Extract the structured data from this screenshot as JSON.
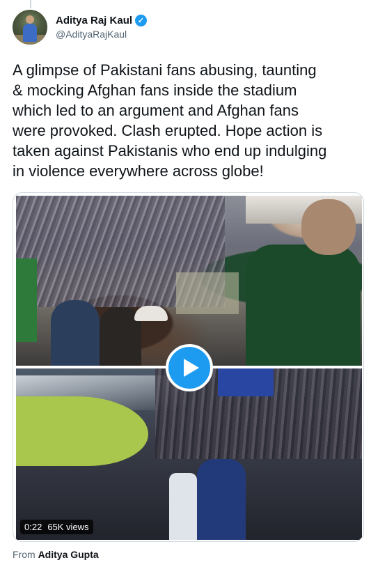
{
  "tweet": {
    "display_name": "Aditya Raj Kaul",
    "verified_icon": "verified-badge-icon",
    "handle": "@AdityaRajKaul",
    "text_lines": [
      "A glimpse of Pakistani fans abusing, taunting",
      "& mocking Afghan fans inside the stadium",
      "which led to an argument and Afghan fans",
      "were provoked. Clash erupted. Hope action is",
      "taken against Pakistanis who end up indulging",
      "in violence everywhere across globe!"
    ]
  },
  "video": {
    "duration": "0:22",
    "views": "65K views",
    "play_icon": "play-icon"
  },
  "source": {
    "prefix": "From",
    "author": "Aditya Gupta"
  },
  "colors": {
    "accent": "#1d9bf0",
    "text": "#0f1419",
    "secondary_text": "#536471"
  }
}
